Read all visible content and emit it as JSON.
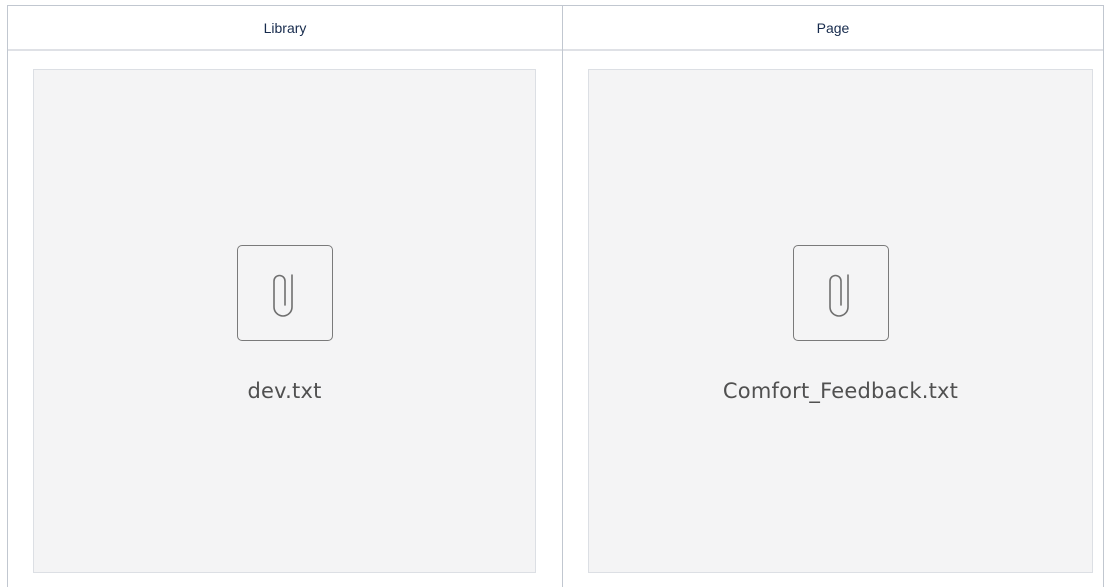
{
  "table": {
    "columns": [
      {
        "header": "Library",
        "attachment": {
          "file_name": "dev.txt",
          "icon": "paperclip-icon"
        }
      },
      {
        "header": "Page",
        "attachment": {
          "file_name": "Comfort_Feedback.txt",
          "icon": "paperclip-icon"
        }
      }
    ]
  },
  "colors": {
    "border": "#c1c7d0",
    "card_background": "#f4f4f5",
    "header_text": "#172b4d",
    "file_text": "#505050"
  }
}
